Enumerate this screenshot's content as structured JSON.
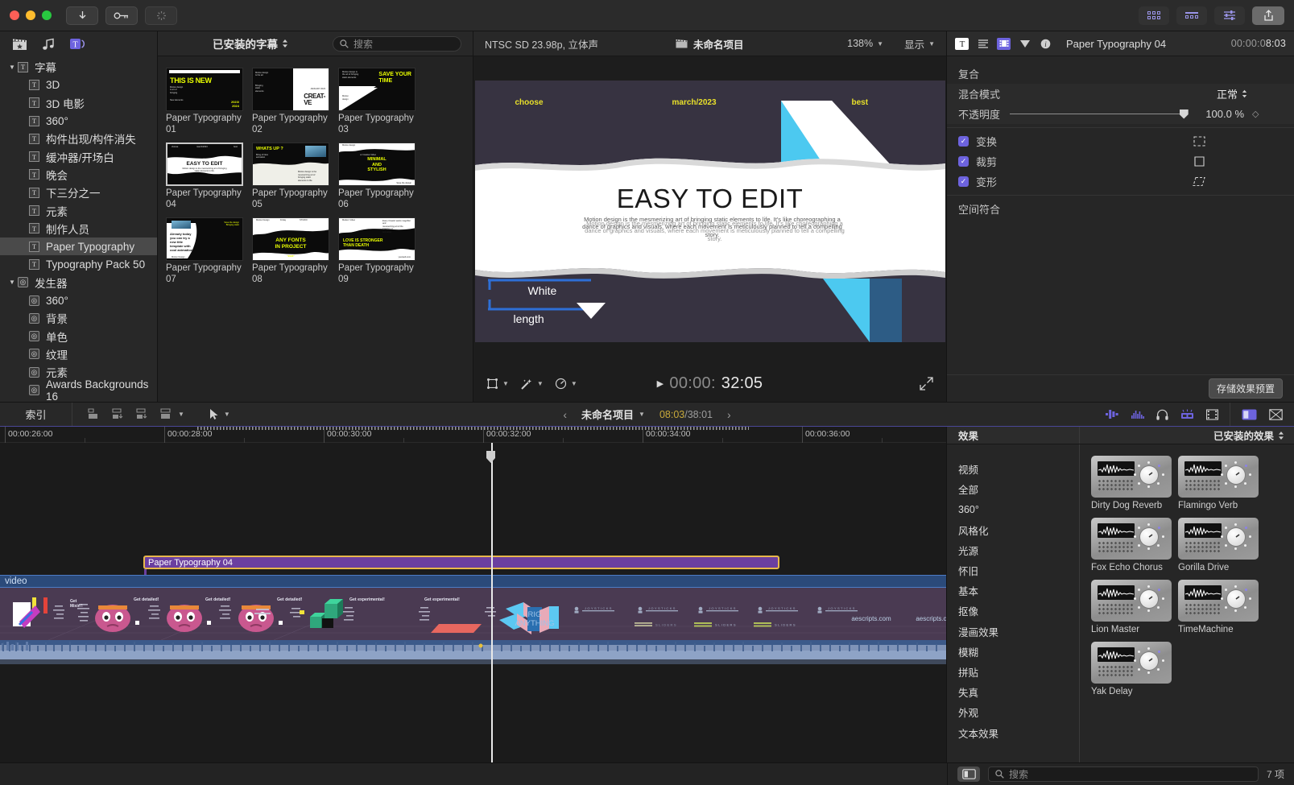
{
  "titlebar": {
    "buttons": [
      {
        "name": "download-button",
        "icon": "download-arrow-icon"
      },
      {
        "name": "keychain-button",
        "icon": "key-icon"
      },
      {
        "name": "progress-button",
        "icon": "spinner-icon"
      }
    ],
    "right_buttons": [
      {
        "name": "browser-toggle-button",
        "icon": "grid-6-icon"
      },
      {
        "name": "timeline-toggle-button",
        "icon": "grid-3-icon"
      },
      {
        "name": "inspector-toggle-button",
        "icon": "sliders-icon"
      },
      {
        "name": "share-button",
        "icon": "share-icon"
      }
    ]
  },
  "sidebar": {
    "tabs": [
      {
        "name": "media-tab",
        "icon": "clapperboard-icon"
      },
      {
        "name": "audio-tab",
        "icon": "music-icon"
      },
      {
        "name": "titles-tab",
        "icon": "title-icon",
        "active": true
      }
    ],
    "items": [
      {
        "label": "字幕",
        "type": "group",
        "icon": "T",
        "indent": 0
      },
      {
        "label": "3D",
        "type": "item",
        "icon": "T",
        "indent": 1
      },
      {
        "label": "3D 电影",
        "type": "item",
        "icon": "T",
        "indent": 1
      },
      {
        "label": "360°",
        "type": "item",
        "icon": "T",
        "indent": 1
      },
      {
        "label": "构件出现/构件消失",
        "type": "item",
        "icon": "T",
        "indent": 1
      },
      {
        "label": "缓冲器/开场白",
        "type": "item",
        "icon": "T",
        "indent": 1
      },
      {
        "label": "晚会",
        "type": "item",
        "icon": "T",
        "indent": 1
      },
      {
        "label": "下三分之一",
        "type": "item",
        "icon": "T",
        "indent": 1
      },
      {
        "label": "元素",
        "type": "item",
        "icon": "T",
        "indent": 1
      },
      {
        "label": "制作人员",
        "type": "item",
        "icon": "T",
        "indent": 1
      },
      {
        "label": "Paper Typography",
        "type": "item",
        "icon": "T",
        "indent": 1,
        "selected": true
      },
      {
        "label": "Typography Pack 50",
        "type": "item",
        "icon": "T",
        "indent": 1
      },
      {
        "label": "发生器",
        "type": "group",
        "icon": "G",
        "indent": 0
      },
      {
        "label": "360°",
        "type": "item",
        "icon": "G",
        "indent": 1
      },
      {
        "label": "背景",
        "type": "item",
        "icon": "G",
        "indent": 1
      },
      {
        "label": "单色",
        "type": "item",
        "icon": "G",
        "indent": 1
      },
      {
        "label": "纹理",
        "type": "item",
        "icon": "G",
        "indent": 1
      },
      {
        "label": "元素",
        "type": "item",
        "icon": "G",
        "indent": 1
      },
      {
        "label": "Awards Backgrounds 16",
        "type": "item",
        "icon": "G",
        "indent": 1
      }
    ]
  },
  "browser": {
    "library_popup": "已安装的字幕",
    "search_placeholder": "搜索",
    "items": [
      {
        "label": "Paper Typography 01",
        "style": "t1",
        "selected": false
      },
      {
        "label": "Paper Typography 02",
        "style": "t2",
        "selected": false
      },
      {
        "label": "Paper Typography 03",
        "style": "t3",
        "selected": false
      },
      {
        "label": "Paper Typography 04",
        "style": "t4",
        "selected": true
      },
      {
        "label": "Paper Typography 05",
        "style": "t5",
        "selected": false
      },
      {
        "label": "Paper Typography 06",
        "style": "t6",
        "selected": false
      },
      {
        "label": "Paper Typography 07",
        "style": "t7",
        "selected": false
      },
      {
        "label": "Paper Typography 08",
        "style": "t8",
        "selected": false
      },
      {
        "label": "Paper Typography 09",
        "style": "t9",
        "selected": false
      }
    ],
    "thumb_text": {
      "t1_head": "THIS IS NEW",
      "t1_corner": "2023/\n2024",
      "t2_head": "CREAT-\nVE",
      "t2_sub": "JANUARY 2023",
      "t3_head": "SAVE YOUR\nTIME",
      "t4_head": "EASY TO EDIT",
      "t5_head": "WHATS UP ?",
      "t6_head": "MINIMAL\nAND\nSTYLISH",
      "t7_head": "Already today\nyou can try a\nnew title\ntemplate with\ncool animation.",
      "t8_head": "ANY FONTS\nIN PROJECT",
      "t9_head": "LOVE IS STRONGER\nTHAN DEATH"
    }
  },
  "viewer": {
    "format": "NTSC SD 23.98p,  立体声",
    "project_name": "未命名项目",
    "zoom": "138%",
    "show_label": "显示",
    "timecode": "00:00:32:05",
    "timecode_dim": "00:00:",
    "timecode_lit": "32:05",
    "frame": {
      "top_labels": [
        "choose",
        "march/2023",
        "best"
      ],
      "headline": "EASY TO EDIT",
      "body": "Motion design is the mesmerizing art of bringing static elements to life. It's like choreographing a dance of graphics and visuals, where each movement is meticulously planned to tell a compelling story.",
      "onscreen_controls": [
        "White",
        "length"
      ]
    },
    "colors": {
      "bg": "#373341",
      "accent_yellow": "#e8e02a",
      "cyan": "#4cc9f0",
      "handle_blue": "#2e6fd6"
    }
  },
  "inspector": {
    "title": "Paper Typography 04",
    "timecode_prefix": "00:00:0",
    "timecode_bold": "8:03",
    "timecode_full": "00:00:08:03",
    "tabs": [
      {
        "name": "text-inspector-tab",
        "icon": "T",
        "active": true
      },
      {
        "name": "generator-inspector-tab",
        "icon": "lines-icon"
      },
      {
        "name": "video-inspector-tab",
        "icon": "filmstrip-icon",
        "accent": true
      },
      {
        "name": "audio-inspector-tab",
        "icon": "triangle-icon"
      },
      {
        "name": "info-inspector-tab",
        "icon": "info-icon"
      }
    ],
    "section_header": "复合",
    "rows": [
      {
        "label": "混合模式",
        "value": "正常",
        "type": "popup"
      },
      {
        "label": "不透明度",
        "value": "100.0 %",
        "type": "slider"
      }
    ],
    "checkboxes": [
      {
        "label": "变换",
        "checked": true,
        "icon": "transform-icon"
      },
      {
        "label": "裁剪",
        "checked": true,
        "icon": "crop-icon"
      },
      {
        "label": "变形",
        "checked": true,
        "icon": "distort-icon"
      }
    ],
    "spatial_label": "空间符合",
    "save_preset_button": "存储效果预置"
  },
  "timeline_toolbar": {
    "index_label": "索引",
    "project_name": "未命名项目",
    "current_time": "08:03",
    "total_time": "38:01",
    "separator": "/",
    "left_icons": [
      "append-icon",
      "insert-icon",
      "connect-icon",
      "overwrite-icon"
    ],
    "tool_icon": "arrow-tool-icon",
    "right_icons": [
      "audio-meter-icon",
      "audio-levels-icon",
      "headphone-icon",
      "skimmer-icon",
      "filmstrip-icon",
      "index-panel-icon",
      "close-panel-icon"
    ]
  },
  "timeline": {
    "ruler_labels": [
      "00:00:26:00",
      "00:00:28:00",
      "00:00:30:00",
      "00:00:32:00",
      "00:00:34:00",
      "00:00:36:00"
    ],
    "selected_clip": "Paper Typography 04",
    "storyline_label": "video",
    "filmstrip_texts": [
      "Get Mixin'!",
      "Get detailed!",
      "Get detailed!",
      "Get detailed!",
      "Get experimental!",
      "Get experimental!",
      "RIG ANYTHING",
      "JOYSTICKS",
      "JOYSTICKS",
      "JOYSTICKS",
      "JOYSTICKS",
      "SLIDERS",
      "SLIDERS",
      "aescripts.com",
      "aescripts.com"
    ],
    "playhead_time": "00:00:32:00"
  },
  "effects": {
    "panel_title": "效果",
    "library_popup": "已安装的效果",
    "categories": [
      "视频",
      "全部",
      "360°",
      "风格化",
      "光源",
      "怀旧",
      "基本",
      "抠像",
      "漫画效果",
      "模糊",
      "拼贴",
      "失真",
      "外观",
      "文本效果"
    ],
    "items": [
      {
        "label": "Dirty Dog Reverb"
      },
      {
        "label": "Flamingo Verb"
      },
      {
        "label": "Fox Echo Chorus"
      },
      {
        "label": "Gorilla Drive"
      },
      {
        "label": "Lion Master"
      },
      {
        "label": "TimeMachine"
      },
      {
        "label": "Yak Delay"
      }
    ]
  },
  "statusbar": {
    "search_placeholder": "搜索",
    "count_label": "7 项",
    "sidebar_toggle": "panel-toggle-icon"
  }
}
